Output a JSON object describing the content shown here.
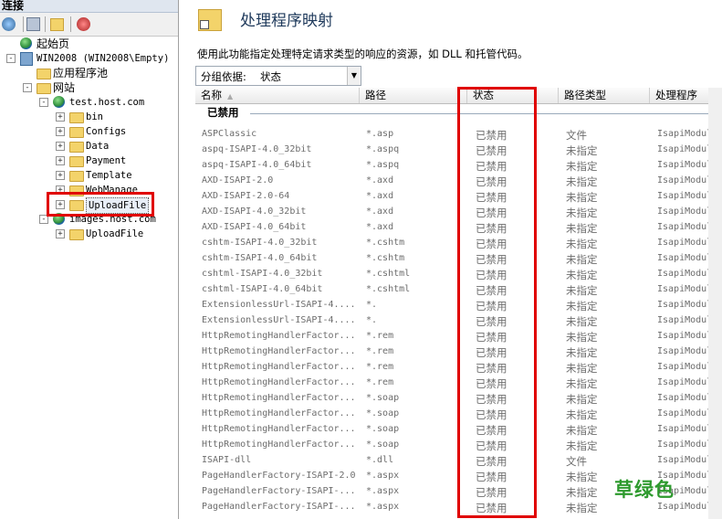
{
  "connections": {
    "header": "连接",
    "tree": [
      {
        "label": "起始页",
        "level": 1,
        "icon": "start-page-icon"
      },
      {
        "label": "WIN2008 (WIN2008\\Empty)",
        "level": 1,
        "icon": "server-icon",
        "expander": "-"
      },
      {
        "label": "应用程序池",
        "level": 2,
        "icon": "app-pool-icon"
      },
      {
        "label": "网站",
        "level": 2,
        "icon": "sites-folder-icon",
        "expander": "-"
      },
      {
        "label": "test.host.com",
        "level": 3,
        "icon": "globe-icon",
        "expander": "-"
      },
      {
        "label": "bin",
        "level": 4,
        "icon": "folder-icon",
        "expander": "+"
      },
      {
        "label": "Configs",
        "level": 4,
        "icon": "folder-icon",
        "expander": "+"
      },
      {
        "label": "Data",
        "level": 4,
        "icon": "folder-icon",
        "expander": "+"
      },
      {
        "label": "Payment",
        "level": 4,
        "icon": "folder-icon",
        "expander": "+"
      },
      {
        "label": "Template",
        "level": 4,
        "icon": "folder-icon",
        "expander": "+"
      },
      {
        "label": "WebManage",
        "level": 4,
        "icon": "folder-icon",
        "expander": "+"
      },
      {
        "label": "UploadFile",
        "level": 4,
        "icon": "folder-icon",
        "expander": "+",
        "selected": true
      },
      {
        "label": "images.host.com",
        "level": 3,
        "icon": "globe-icon",
        "expander": "-"
      },
      {
        "label": "UploadFile",
        "level": 4,
        "icon": "folder-icon",
        "expander": "+"
      }
    ]
  },
  "main": {
    "title": "处理程序映射",
    "description": "使用此功能指定处理特定请求类型的响应的资源，如 DLL 和托管代码。",
    "group_by_label": "分组依据:",
    "group_by_value": "状态",
    "columns": [
      "名称",
      "路径",
      "状态",
      "路径类型",
      "处理程序"
    ],
    "group_header": "已禁用",
    "rows": [
      [
        "ASPClassic",
        "*.asp",
        "已禁用",
        "文件",
        "IsapiModul"
      ],
      [
        "aspq-ISAPI-4.0_32bit",
        "*.aspq",
        "已禁用",
        "未指定",
        "IsapiModul"
      ],
      [
        "aspq-ISAPI-4.0_64bit",
        "*.aspq",
        "已禁用",
        "未指定",
        "IsapiModul"
      ],
      [
        "AXD-ISAPI-2.0",
        "*.axd",
        "已禁用",
        "未指定",
        "IsapiModul"
      ],
      [
        "AXD-ISAPI-2.0-64",
        "*.axd",
        "已禁用",
        "未指定",
        "IsapiModul"
      ],
      [
        "AXD-ISAPI-4.0_32bit",
        "*.axd",
        "已禁用",
        "未指定",
        "IsapiModul"
      ],
      [
        "AXD-ISAPI-4.0_64bit",
        "*.axd",
        "已禁用",
        "未指定",
        "IsapiModul"
      ],
      [
        "cshtm-ISAPI-4.0_32bit",
        "*.cshtm",
        "已禁用",
        "未指定",
        "IsapiModul"
      ],
      [
        "cshtm-ISAPI-4.0_64bit",
        "*.cshtm",
        "已禁用",
        "未指定",
        "IsapiModul"
      ],
      [
        "cshtml-ISAPI-4.0_32bit",
        "*.cshtml",
        "已禁用",
        "未指定",
        "IsapiModul"
      ],
      [
        "cshtml-ISAPI-4.0_64bit",
        "*.cshtml",
        "已禁用",
        "未指定",
        "IsapiModul"
      ],
      [
        "ExtensionlessUrl-ISAPI-4....",
        "*.",
        "已禁用",
        "未指定",
        "IsapiModul"
      ],
      [
        "ExtensionlessUrl-ISAPI-4....",
        "*.",
        "已禁用",
        "未指定",
        "IsapiModul"
      ],
      [
        "HttpRemotingHandlerFactor...",
        "*.rem",
        "已禁用",
        "未指定",
        "IsapiModul"
      ],
      [
        "HttpRemotingHandlerFactor...",
        "*.rem",
        "已禁用",
        "未指定",
        "IsapiModul"
      ],
      [
        "HttpRemotingHandlerFactor...",
        "*.rem",
        "已禁用",
        "未指定",
        "IsapiModul"
      ],
      [
        "HttpRemotingHandlerFactor...",
        "*.rem",
        "已禁用",
        "未指定",
        "IsapiModul"
      ],
      [
        "HttpRemotingHandlerFactor...",
        "*.soap",
        "已禁用",
        "未指定",
        "IsapiModul"
      ],
      [
        "HttpRemotingHandlerFactor...",
        "*.soap",
        "已禁用",
        "未指定",
        "IsapiModul"
      ],
      [
        "HttpRemotingHandlerFactor...",
        "*.soap",
        "已禁用",
        "未指定",
        "IsapiModul"
      ],
      [
        "HttpRemotingHandlerFactor...",
        "*.soap",
        "已禁用",
        "未指定",
        "IsapiModul"
      ],
      [
        "ISAPI-dll",
        "*.dll",
        "已禁用",
        "文件",
        "IsapiModul"
      ],
      [
        "PageHandlerFactory-ISAPI-2.0",
        "*.aspx",
        "已禁用",
        "未指定",
        "IsapiModul"
      ],
      [
        "PageHandlerFactory-ISAPI-...",
        "*.aspx",
        "已禁用",
        "未指定",
        "IsapiModul"
      ],
      [
        "PageHandlerFactory-ISAPI-...",
        "*.aspx",
        "已禁用",
        "未指定",
        "IsapiModul"
      ]
    ]
  },
  "watermark": "草绿色",
  "colors": {
    "highlight_box": "#e00000",
    "title": "#1e395b",
    "watermark": "#2e9a2e"
  }
}
